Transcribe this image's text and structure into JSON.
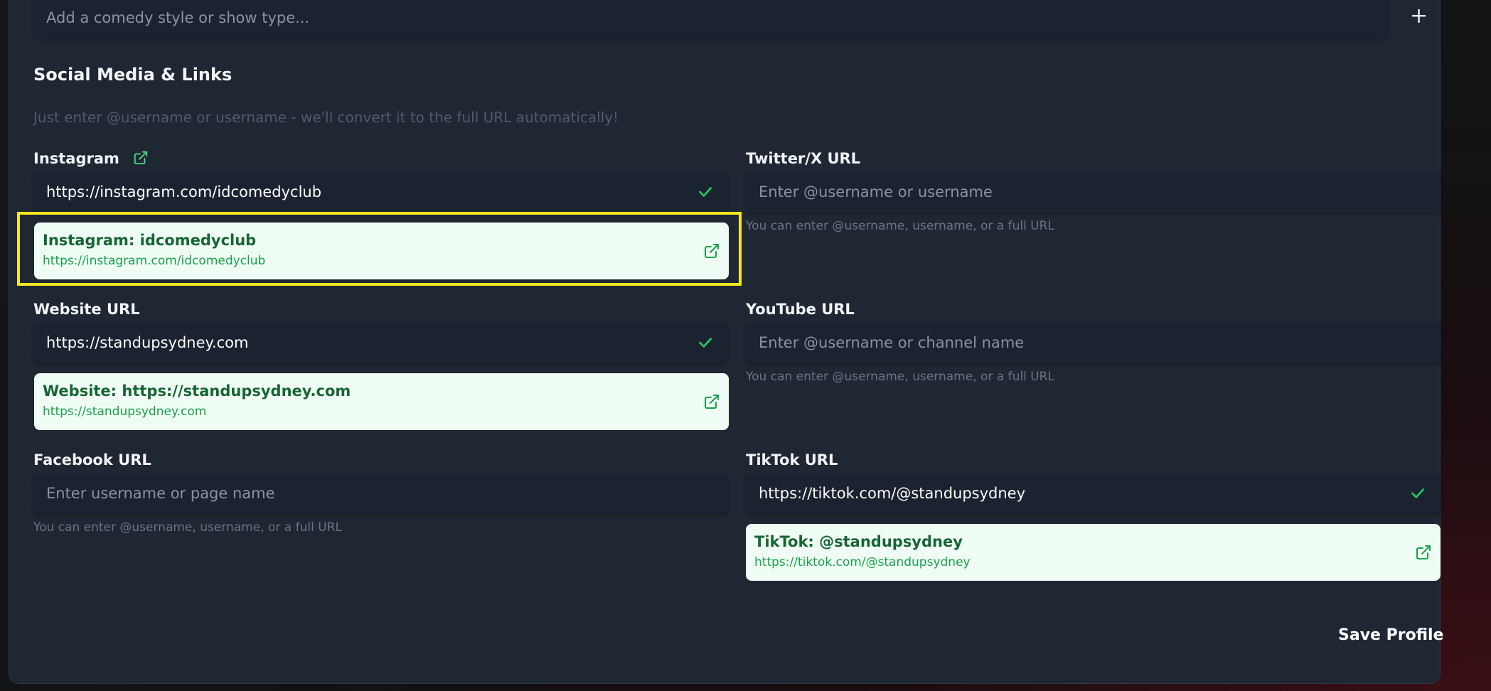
{
  "styles_input": {
    "placeholder": "Add a comedy style or show type..."
  },
  "section": {
    "title": "Social Media & Links",
    "hint": "Just enter @username or username - we'll convert it to the full URL automatically!"
  },
  "instagram": {
    "label": "Instagram",
    "value": "https://instagram.com/idcomedyclub",
    "preview_title": "Instagram: idcomedyclub",
    "preview_url": "https://instagram.com/idcomedyclub"
  },
  "twitter": {
    "label": "Twitter/X URL",
    "placeholder": "Enter @username or username",
    "hint": "You can enter @username, username, or a full URL"
  },
  "website": {
    "label": "Website URL",
    "value": "https://standupsydney.com",
    "preview_title": "Website: https://standupsydney.com",
    "preview_url": "https://standupsydney.com"
  },
  "youtube": {
    "label": "YouTube URL",
    "placeholder": "Enter @username or channel name",
    "hint": "You can enter @username, username, or a full URL"
  },
  "facebook": {
    "label": "Facebook URL",
    "placeholder": "Enter username or page name",
    "hint": "You can enter @username, username, or a full URL"
  },
  "tiktok": {
    "label": "TikTok URL",
    "value": "https://tiktok.com/@standupsydney",
    "preview_title": "TikTok: @standupsydney",
    "preview_url": "https://tiktok.com/@standupsydney"
  },
  "save_label": "Save Profile",
  "icons": {
    "add": "plus-icon",
    "valid": "check-icon",
    "open": "external-link-icon"
  },
  "colors": {
    "valid_check": "#22c55e",
    "preview_bg": "#f0fdf4",
    "preview_title": "#166534",
    "preview_url": "#16a34a",
    "highlight": "#f5e81f"
  }
}
